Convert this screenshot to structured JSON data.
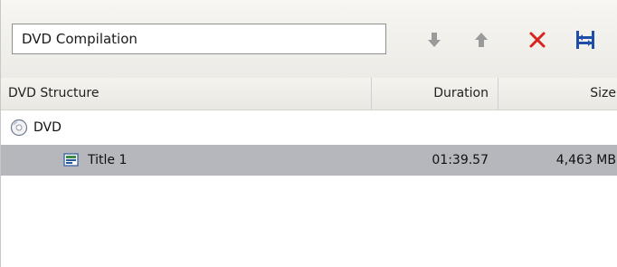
{
  "compilation_name": "DVD Compilation",
  "toolbar": {
    "buttons": [
      {
        "icon": "arrow-down-icon",
        "color": "#9a9a9a"
      },
      {
        "icon": "arrow-up-icon",
        "color": "#9a9a9a"
      },
      {
        "icon": "delete-icon",
        "color": "#d8231f"
      },
      {
        "icon": "properties-icon",
        "color": "#1f4ea8"
      }
    ]
  },
  "columns": {
    "structure": "DVD Structure",
    "duration": "Duration",
    "size": "Size"
  },
  "tree": {
    "root": {
      "label": "DVD",
      "icon": "disc-icon"
    },
    "titles": [
      {
        "label": "Title 1",
        "icon": "title-icon",
        "duration": "01:39.57",
        "size": "4,463 MB",
        "selected": true
      }
    ]
  },
  "colors": {
    "selection": "#b6b6bd",
    "toolbar_bg": "#f1f0eb"
  }
}
